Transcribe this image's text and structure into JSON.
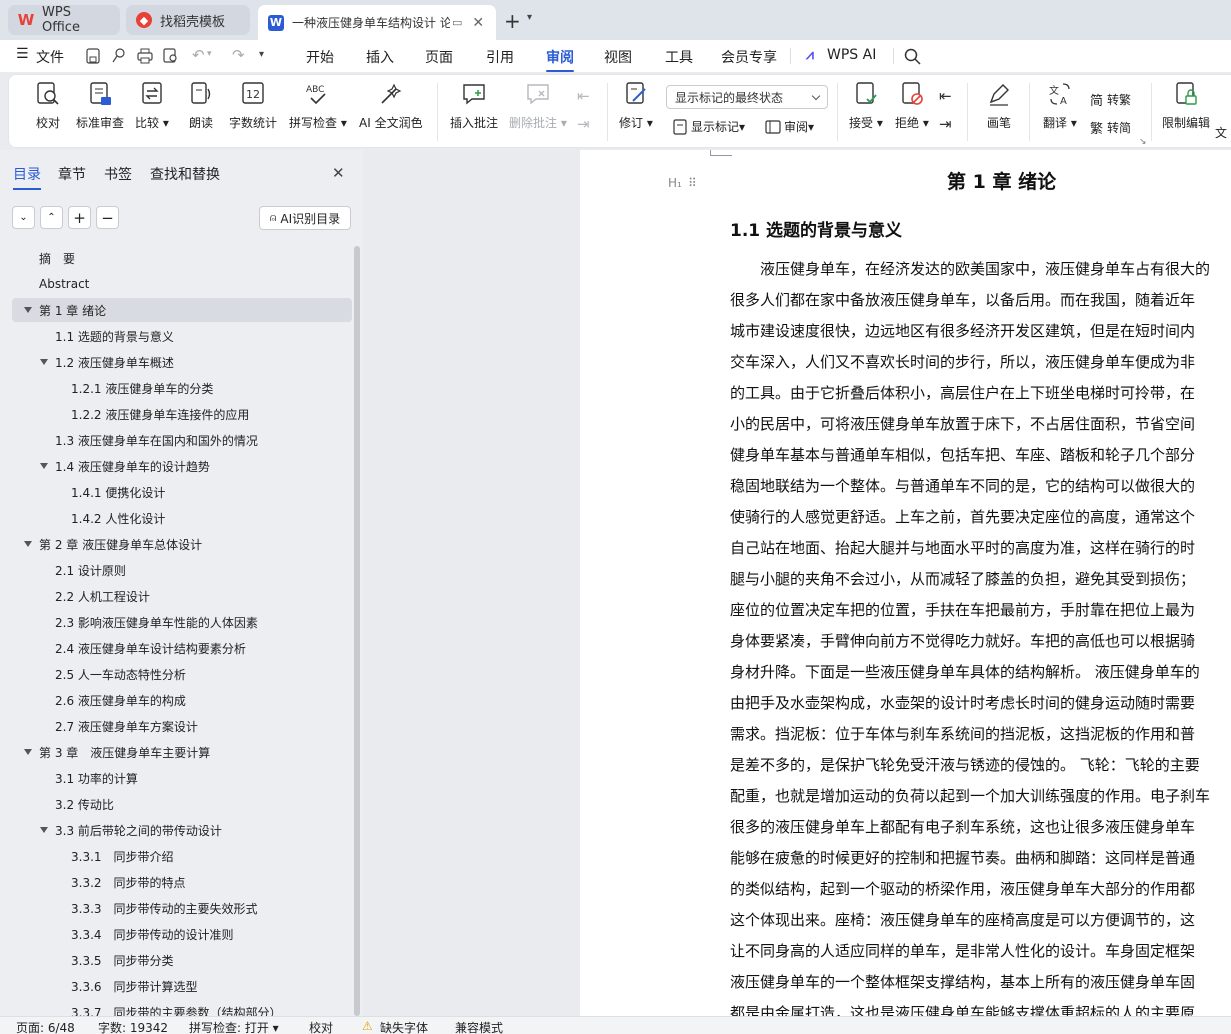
{
  "tabs": [
    {
      "label": "WPS Office",
      "icon": "wps-logo-icon",
      "color": "#e8413a"
    },
    {
      "label": "找稻壳模板",
      "icon": "docer-icon",
      "color": "#e8413a"
    },
    {
      "label": "一种液压健身单车结构设计 论",
      "icon": "word-doc-icon",
      "color": "#2b5cd6",
      "active": true
    }
  ],
  "menu": {
    "file": "文件",
    "items": [
      "开始",
      "插入",
      "页面",
      "引用",
      "审阅",
      "视图",
      "工具",
      "会员专享"
    ],
    "active": "审阅",
    "wps_ai": "WPS AI"
  },
  "ribbon": {
    "proofread": "校对",
    "std_review": "标准审查",
    "compare": "比较",
    "read_aloud": "朗读",
    "word_count": "字数统计",
    "spell_check": "拼写检查",
    "ai_polish": "AI 全文润色",
    "insert_comment": "插入批注",
    "delete_comment": "删除批注",
    "revise": "修订",
    "markup_dropdown": "显示标记的最终状态",
    "show_markup": "显示标记",
    "review": "审阅",
    "accept": "接受",
    "reject": "拒绝",
    "pen": "画笔",
    "translate": "翻译",
    "to_traditional": "转繁",
    "to_simplified": "转简",
    "restrict_edit": "限制编辑",
    "doc_partial": "文"
  },
  "panel": {
    "tabs": [
      "目录",
      "章节",
      "书签",
      "查找和替换"
    ],
    "active_tab": "目录",
    "ai_toc": "AI识别目录",
    "toc": [
      {
        "label": "摘　要",
        "level": 1,
        "arrow": false
      },
      {
        "label": "Abstract",
        "level": 1,
        "arrow": false
      },
      {
        "label": "第 1 章  绪论",
        "level": 1,
        "arrow": true,
        "sel": true
      },
      {
        "label": "1.1  选题的背景与意义",
        "level": 2,
        "arrow": false
      },
      {
        "label": "1.2  液压健身单车概述",
        "level": 2,
        "arrow": true
      },
      {
        "label": "1.2.1  液压健身单车的分类",
        "level": 3,
        "arrow": false
      },
      {
        "label": "1.2.2  液压健身单车连接件的应用",
        "level": 3,
        "arrow": false
      },
      {
        "label": "1.3  液压健身单车在国内和国外的情况",
        "level": 2,
        "arrow": false
      },
      {
        "label": "1.4  液压健身单车的设计趋势",
        "level": 2,
        "arrow": true
      },
      {
        "label": "1.4.1  便携化设计",
        "level": 3,
        "arrow": false
      },
      {
        "label": "1.4.2  人性化设计",
        "level": 3,
        "arrow": false
      },
      {
        "label": "第 2 章  液压健身单车总体设计",
        "level": 1,
        "arrow": true
      },
      {
        "label": "2.1  设计原则",
        "level": 2,
        "arrow": false
      },
      {
        "label": "2.2  人机工程设计",
        "level": 2,
        "arrow": false
      },
      {
        "label": "2.3  影响液压健身单车性能的人体因素",
        "level": 2,
        "arrow": false
      },
      {
        "label": "2.4  液压健身单车设计结构要素分析",
        "level": 2,
        "arrow": false
      },
      {
        "label": "2.5  人一车动态特性分析",
        "level": 2,
        "arrow": false
      },
      {
        "label": "2.6  液压健身单车的构成",
        "level": 2,
        "arrow": false
      },
      {
        "label": "2.7  液压健身单车方案设计",
        "level": 2,
        "arrow": false
      },
      {
        "label": "第 3 章　液压健身单车主要计算",
        "level": 1,
        "arrow": true
      },
      {
        "label": "3.1 功率的计算",
        "level": 2,
        "arrow": false
      },
      {
        "label": "3.2 传动比",
        "level": 2,
        "arrow": false
      },
      {
        "label": "3.3 前后带轮之间的带传动设计",
        "level": 2,
        "arrow": true
      },
      {
        "label": "3.3.1　同步带介绍",
        "level": 3,
        "arrow": false
      },
      {
        "label": "3.3.2　同步带的特点",
        "level": 3,
        "arrow": false
      },
      {
        "label": "3.3.3　同步带传动的主要失效形式",
        "level": 3,
        "arrow": false
      },
      {
        "label": "3.3.4　同步带传动的设计准则",
        "level": 3,
        "arrow": false
      },
      {
        "label": "3.3.5　同步带分类",
        "level": 3,
        "arrow": false
      },
      {
        "label": "3.3.6　同步带计算选型",
        "level": 3,
        "arrow": false
      },
      {
        "label": "3.3.7　同步带的主要参数（结构部分）",
        "level": 3,
        "arrow": false
      }
    ]
  },
  "document": {
    "heading_marker": "H₁",
    "chapter_title": "第 1 章  绪论",
    "section_title": "1.1  选题的背景与意义",
    "lines": [
      "　　液压健身单车，在经济发达的欧美国家中，液压健身单车占有很大的",
      "很多人们都在家中备放液压健身单车，以备后用。而在我国，随着近年",
      "城市建设速度很快，边远地区有很多经济开发区建筑，但是在短时间内",
      "交车深入，人们又不喜欢长时间的步行，所以，液压健身单车便成为非",
      "的工具。由于它折叠后体积小，高层住户在上下班坐电梯时可拎带，在",
      "小的民居中，可将液压健身单车放置于床下，不占居住面积，节省空间",
      "健身单车基本与普通单车相似，包括车把、车座、踏板和轮子几个部分",
      "稳固地联结为一个整体。与普通单车不同的是，它的结构可以做很大的",
      "使骑行的人感觉更舒适。上车之前，首先要决定座位的高度，通常这个",
      "自己站在地面、抬起大腿并与地面水平时的高度为准，这样在骑行的时",
      "腿与小腿的夹角不会过小，从而减轻了膝盖的负担，避免其受到损伤；",
      "座位的位置决定车把的位置，手扶在车把最前方，手肘靠在把位上最为",
      "身体要紧凑，手臂伸向前方不觉得吃力就好。车把的高低也可以根据骑",
      "身材升降。下面是一些液压健身单车具体的结构解析。 液压健身单车的",
      "由把手及水壶架构成，水壶架的设计时考虑长时间的健身运动随时需要",
      "需求。挡泥板：位于车体与刹车系统间的挡泥板，这挡泥板的作用和普",
      "是差不多的，是保护飞轮免受汗液与锈迹的侵蚀的。 飞轮：飞轮的主要",
      "配重，也就是增加运动的负荷以起到一个加大训练强度的作用。电子刹车",
      "很多的液压健身单车上都配有电子刹车系统，这也让很多液压健身单车",
      "能够在疲惫的时候更好的控制和把握节奏。曲柄和脚踏：这同样是普通",
      "的类似结构，起到一个驱动的桥梁作用，液压健身单车大部分的作用都",
      "这个体现出来。座椅：液压健身单车的座椅高度是可以方便调节的，这",
      "让不同身高的人适应同样的单车，是非常人性化的设计。车身固定框架",
      "液压健身单车的一个整体框架支撑结构，基本上所有的液压健身单车固",
      "都是由金属打造，这也是液压健身单车能够支撑体重超标的人的主要原"
    ]
  },
  "status": {
    "page": "页面: 6/48",
    "words": "字数: 19342",
    "spell": "拼写检查: 打开",
    "proof": "校对",
    "font_missing": "缺失字体",
    "compat": "兼容模式"
  }
}
